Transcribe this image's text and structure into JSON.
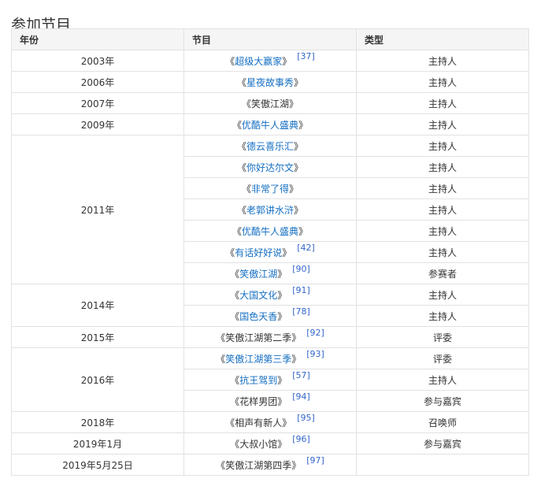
{
  "section": {
    "title": "参加节目"
  },
  "table": {
    "headers": [
      "年份",
      "节目",
      "类型"
    ],
    "rows": [
      {
        "year": "2003年",
        "year_rowspan": 1,
        "program": "超级大赢家",
        "linked": true,
        "ref": "[37]",
        "type": "主持人"
      },
      {
        "year": "2006年",
        "year_rowspan": 1,
        "program": "星夜故事秀",
        "linked": true,
        "ref": "",
        "type": "主持人"
      },
      {
        "year": "2007年",
        "year_rowspan": 1,
        "program": "笑傲江湖",
        "linked": false,
        "ref": "",
        "type": "主持人"
      },
      {
        "year": "2009年",
        "year_rowspan": 1,
        "program": "优酷牛人盛典",
        "linked": true,
        "ref": "",
        "type": "主持人"
      },
      {
        "year": "2011年",
        "year_rowspan": 7,
        "program": "德云喜乐汇",
        "linked": true,
        "ref": "",
        "type": "主持人"
      },
      {
        "year": null,
        "program": "你好达尔文",
        "linked": true,
        "ref": "",
        "type": "主持人"
      },
      {
        "year": null,
        "program": "非常了得",
        "linked": true,
        "ref": "",
        "type": "主持人"
      },
      {
        "year": null,
        "program": "老郭讲水浒",
        "linked": true,
        "ref": "",
        "type": "主持人"
      },
      {
        "year": null,
        "program": "优酷牛人盛典",
        "linked": true,
        "ref": "",
        "type": "主持人"
      },
      {
        "year": null,
        "program": "有话好好说",
        "linked": true,
        "ref": "[42]",
        "type": "主持人"
      },
      {
        "year": null,
        "program": "笑傲江湖",
        "linked": true,
        "ref": "[90]",
        "type": "参赛者"
      },
      {
        "year": "2014年",
        "year_rowspan": 2,
        "program": "大国文化",
        "linked": true,
        "ref": "[91]",
        "type": "主持人"
      },
      {
        "year": null,
        "program": "国色天香",
        "linked": true,
        "ref": "[78]",
        "type": "主持人"
      },
      {
        "year": "2015年",
        "year_rowspan": 1,
        "program": "笑傲江湖第二季",
        "linked": false,
        "ref": "[92]",
        "type": "评委"
      },
      {
        "year": "2016年",
        "year_rowspan": 3,
        "program": "笑傲江湖第三季",
        "linked": true,
        "ref": "[93]",
        "type": "评委"
      },
      {
        "year": null,
        "program": "抗王驾到",
        "linked": true,
        "ref": "[57]",
        "type": "主持人"
      },
      {
        "year": null,
        "program": "花样男团",
        "linked": false,
        "ref": "[94]",
        "type": "参与嘉宾"
      },
      {
        "year": "2018年",
        "year_rowspan": 1,
        "program": "相声有新人",
        "linked": false,
        "ref": "[95]",
        "type": "召唤师"
      },
      {
        "year": "2019年1月",
        "year_rowspan": 1,
        "program": "大叔小馆",
        "linked": false,
        "ref": "[96]",
        "type": "参与嘉宾"
      },
      {
        "year": "2019年5月25日",
        "year_rowspan": 1,
        "program": "笑傲江湖第四季",
        "linked": false,
        "ref": "[97]",
        "type": ""
      }
    ]
  }
}
